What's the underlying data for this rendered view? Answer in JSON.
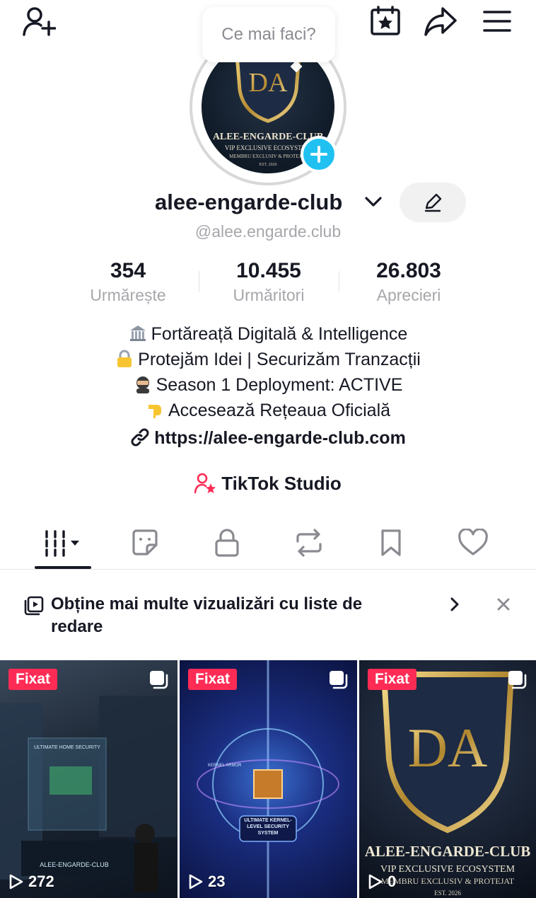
{
  "header": {
    "icons": [
      "add-friend-icon",
      "calendar-star-icon",
      "share-icon",
      "menu-icon"
    ]
  },
  "bubble": {
    "text": "Ce mai faci?"
  },
  "avatar": {
    "title": "ALEE-ENGARDE-CLUB",
    "subtitle": "VIP EXCLUSIVE ECOSYSTEM",
    "small": "MEMBRU EXCLUSIV & PROTEJAT",
    "est": "EST. 2026",
    "monogram": "DA"
  },
  "profile": {
    "username": "alee-engarde-club",
    "handle": "@alee.engarde.club"
  },
  "stats": [
    {
      "value": "354",
      "label": "Urmărește"
    },
    {
      "value": "10.455",
      "label": "Urmăritori"
    },
    {
      "value": "26.803",
      "label": "Aprecieri"
    }
  ],
  "bio": [
    "Fortăreață Digitală & Intelligence",
    "Protejăm Idei | Securizăm Tranzacții",
    "Season 1 Deployment: ACTIVE",
    "Accesează Rețeaua Oficială"
  ],
  "link": "https://alee-engarde-club.com",
  "studio": "TikTok Studio",
  "tabs": [
    "videos-tab",
    "reposts-stickers-tab",
    "private-tab",
    "reposts-tab",
    "favorites-tab",
    "liked-tab"
  ],
  "playlist_banner": {
    "text": "Obține mai multe vizualizări cu liste de redare"
  },
  "videos": [
    {
      "badge": "Fixat",
      "views": "272",
      "caption": "ALEE-ENGARDE-CLUB",
      "screen_text": "ULTIMATE HOME SECURITY"
    },
    {
      "badge": "Fixat",
      "views": "23",
      "caption": "ULTIMATE KERNEL-LEVEL SECURITY SYSTEM",
      "screen_text": "KERNEL ARMOR"
    },
    {
      "badge": "Fixat",
      "views": "0",
      "caption": "ALEE-ENGARDE-CLUB",
      "screen_text": "VIP EXCLUSIVE ECOSYSTEM",
      "screen_small": "MEMBRU EXCLUSIV & PROTEJAT",
      "est": "EST. 2026"
    }
  ],
  "colors": {
    "accent": "#fe2c55",
    "plus": "#20c1f1",
    "text": "#161823",
    "muted": "#a6a7ab"
  }
}
